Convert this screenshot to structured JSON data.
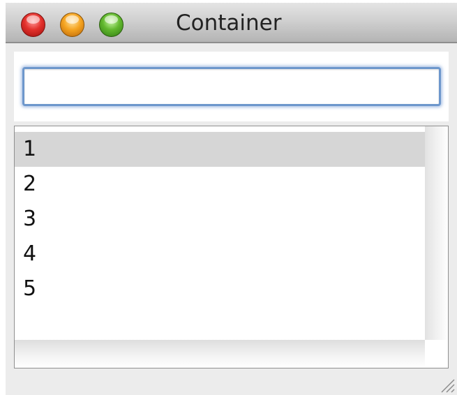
{
  "window": {
    "title": "Container",
    "buttons": {
      "close": "close-button",
      "minimize": "minimize-button",
      "zoom": "zoom-button"
    }
  },
  "search": {
    "value": "",
    "placeholder": ""
  },
  "list": {
    "items": [
      "1",
      "2",
      "3",
      "4",
      "5"
    ],
    "selected_index": 0
  },
  "colors": {
    "focus_ring": "#6d97cc",
    "selection": "#d6d6d6",
    "close": "#e3312c",
    "minimize": "#f5a420",
    "zoom": "#62b82e"
  }
}
